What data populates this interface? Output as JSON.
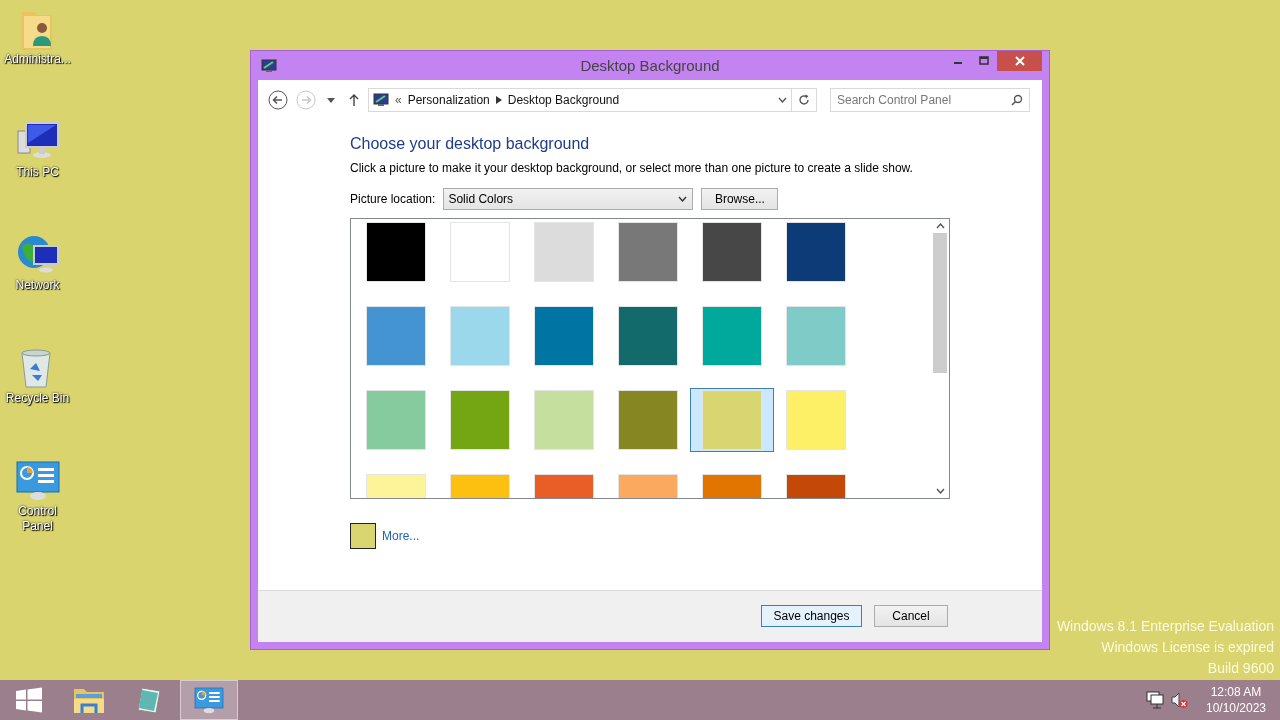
{
  "desktop_icons": [
    {
      "kind": "user-folder",
      "label": "Administra..."
    },
    {
      "kind": "computer",
      "label": "This PC"
    },
    {
      "kind": "network",
      "label": "Network"
    },
    {
      "kind": "recycle-bin",
      "label": "Recycle Bin"
    },
    {
      "kind": "control-panel",
      "label": "Control Panel"
    }
  ],
  "window": {
    "title": "Desktop Background",
    "navigation": {
      "back_disabled": false,
      "forward_disabled": true
    },
    "address": {
      "separator": "«",
      "crumbs": [
        "Personalization",
        "Desktop Background"
      ]
    },
    "search": {
      "placeholder": "Search Control Panel"
    },
    "heading": "Choose your desktop background",
    "description": "Click a picture to make it your desktop background, or select more than one picture to create a slide show.",
    "picture_location": {
      "label": "Picture location:",
      "value": "Solid Colors",
      "browse": "Browse..."
    },
    "swatches": [
      {
        "color": "#000000",
        "selected": false
      },
      {
        "color": "#ffffff",
        "selected": false
      },
      {
        "color": "#dcdcdc",
        "selected": false
      },
      {
        "color": "#787878",
        "selected": false
      },
      {
        "color": "#474747",
        "selected": false
      },
      {
        "color": "#0c3b78",
        "selected": false
      },
      {
        "color": "#4494d4",
        "selected": false
      },
      {
        "color": "#9bd8ec",
        "selected": false
      },
      {
        "color": "#0074a2",
        "selected": false
      },
      {
        "color": "#126a6b",
        "selected": false
      },
      {
        "color": "#00a99c",
        "selected": false
      },
      {
        "color": "#7ecbc8",
        "selected": false
      },
      {
        "color": "#86cb9d",
        "selected": false
      },
      {
        "color": "#74a512",
        "selected": false
      },
      {
        "color": "#c5df9f",
        "selected": false
      },
      {
        "color": "#868722",
        "selected": false
      },
      {
        "color": "#d9d672",
        "selected": true
      },
      {
        "color": "#fdf066",
        "selected": false
      },
      {
        "color": "#fdf398",
        "selected": false
      },
      {
        "color": "#fdc010",
        "selected": false
      },
      {
        "color": "#e95e26",
        "selected": false
      },
      {
        "color": "#faa95e",
        "selected": false
      },
      {
        "color": "#e27400",
        "selected": false
      },
      {
        "color": "#c44807",
        "selected": false
      }
    ],
    "more": {
      "color": "#d9d672",
      "label": "More..."
    },
    "buttons": [
      {
        "label": "Save changes",
        "default": true
      },
      {
        "label": "Cancel",
        "default": false
      }
    ]
  },
  "watermark_lines": [
    "Windows 8.1 Enterprise Evaluation",
    "Windows License is expired",
    "Build 9600"
  ],
  "taskbar": {
    "items": [
      {
        "kind": "start",
        "selected": false
      },
      {
        "kind": "explorer",
        "selected": false
      },
      {
        "kind": "notepad",
        "selected": false
      },
      {
        "kind": "control-panel",
        "selected": true
      }
    ],
    "tray": {
      "volume_muted": true
    },
    "time": "12:08 AM",
    "date": "10/10/2023"
  }
}
